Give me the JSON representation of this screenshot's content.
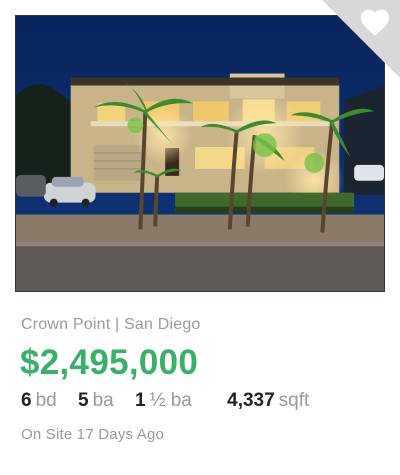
{
  "listing": {
    "location": "Crown Point | San Diego",
    "price": "$2,495,000",
    "beds_value": "6",
    "beds_unit": "bd",
    "baths_value": "5",
    "baths_unit": "ba",
    "half_baths_value": "1",
    "half_baths_unit": "½ ba",
    "sqft_value": "4,337",
    "sqft_unit": "sqft",
    "on_site": "On Site 17 Days Ago"
  },
  "favorite": {
    "icon": "heart-icon",
    "saved": false
  },
  "colors": {
    "price": "#3aaf6a",
    "muted_text": "#9a9a9a",
    "strong_text": "#222222",
    "corner_fold": "#d8d8d8"
  }
}
